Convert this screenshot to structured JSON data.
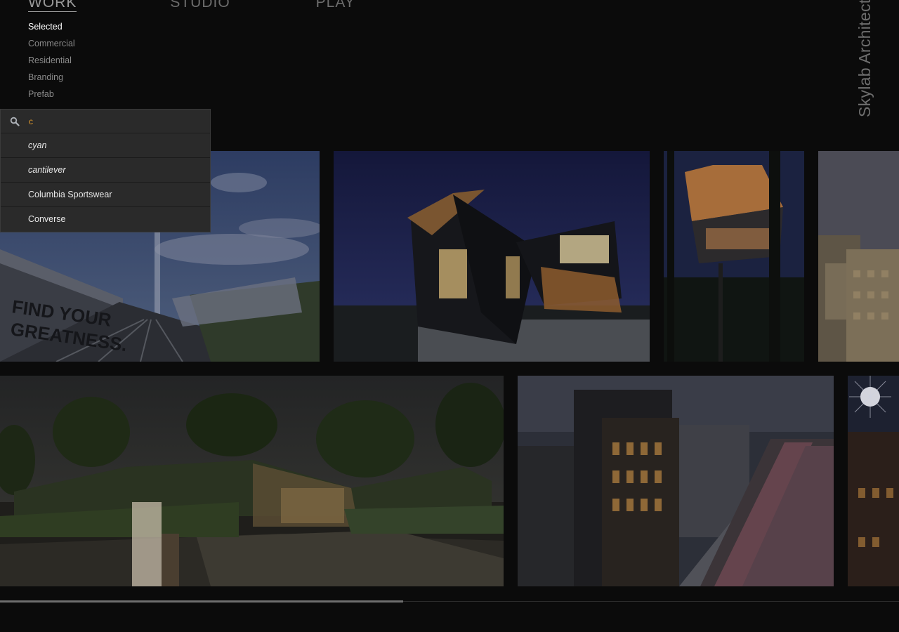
{
  "nav": {
    "items": [
      "WORK",
      "STUDIO",
      "PLAY"
    ]
  },
  "subnav": {
    "items": [
      "Selected",
      "Commercial",
      "Residential",
      "Branding",
      "Prefab"
    ],
    "active": "Selected"
  },
  "brand": "Skylab Architecture",
  "search": {
    "value": "c",
    "icon": "search-icon",
    "suggestions": [
      {
        "label": "cyan",
        "kind": "tag"
      },
      {
        "label": "cantilever",
        "kind": "tag"
      },
      {
        "label": "Columbia Sportswear",
        "kind": "project"
      },
      {
        "label": "Converse",
        "kind": "project"
      }
    ]
  },
  "gallery": {
    "row1": [
      "nike-track-rendering",
      "modern-house-dusk",
      "treehouse-cantilever",
      "city-buildings"
    ],
    "row2": [
      "green-roof-building-night",
      "brick-building-street",
      "building-with-sunburst"
    ],
    "billboard_text": [
      "FIND YOUR",
      "GREATNESS."
    ]
  },
  "colors": {
    "background": "#0b0b0b",
    "accent": "#e09a2c",
    "dropdown": "#2a2a2a"
  }
}
